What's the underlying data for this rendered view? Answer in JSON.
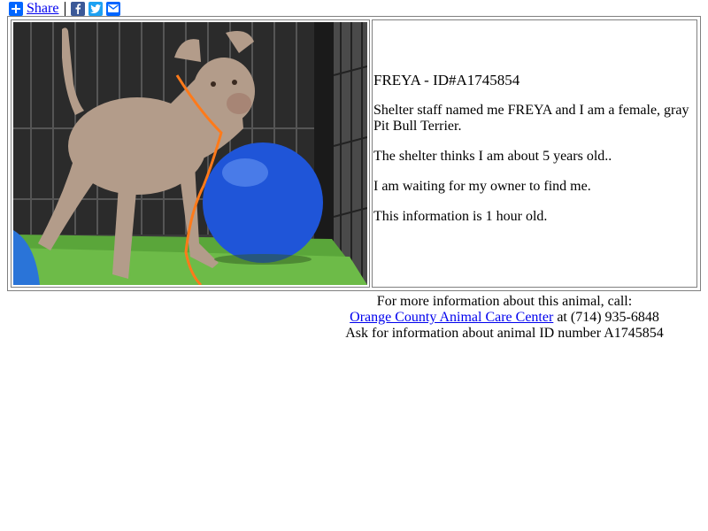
{
  "share": {
    "label": "Share",
    "icons": [
      "plus-icon",
      "facebook-icon",
      "twitter-icon",
      "email-icon"
    ]
  },
  "animal": {
    "title": "FREYA - ID#A1745854",
    "description": "Shelter staff named me FREYA and I am a female, gray Pit Bull Terrier.",
    "age": "The shelter thinks I am about 5 years old..",
    "status": "I am waiting for my owner to find me.",
    "freshness": "This information is 1 hour old."
  },
  "contact": {
    "intro": "For more information about this animal, call:",
    "shelter_name": "Orange County Animal Care Center",
    "phone_text": " at (714) 935-6848",
    "ask_text": "Ask for information about animal ID number A1745854"
  },
  "colors": {
    "link": "#0000ee",
    "share_blue": "#0166ff",
    "facebook": "#3b5998",
    "twitter": "#1da1f2"
  }
}
